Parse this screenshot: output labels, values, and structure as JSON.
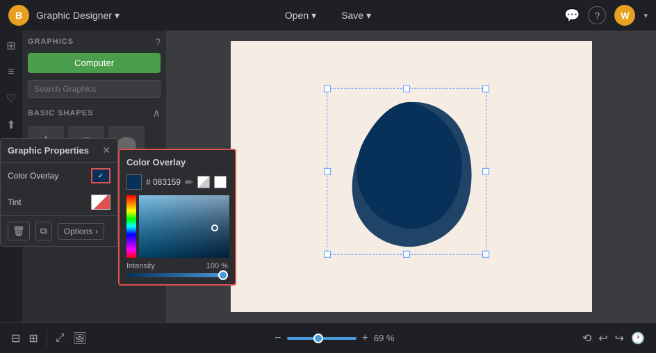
{
  "app": {
    "logo_letter": "B",
    "title": "Graphic Designer",
    "title_chevron": "▾"
  },
  "topbar": {
    "open_label": "Open",
    "save_label": "Save",
    "open_chevron": "▾",
    "save_chevron": "▾",
    "chat_icon": "💬",
    "help_icon": "?",
    "avatar_label": "W"
  },
  "sidebar": {
    "header": "GRAPHICS",
    "help_icon": "?",
    "computer_btn": "Computer",
    "search_placeholder": "Search Graphics",
    "basic_shapes_label": "BASIC SHAPES",
    "collapse_icon": "∧"
  },
  "graphic_properties": {
    "title": "Graphic Properties",
    "close_icon": "✕",
    "color_overlay_label": "Color Overlay",
    "tint_label": "Tint",
    "options_label": "Options",
    "options_chevron": "›",
    "trash_icon": "🗑",
    "copy_icon": "⧉"
  },
  "color_overlay": {
    "title": "Color Overlay",
    "hex_value": "# 083159",
    "eyedropper_icon": "✏",
    "intensity_label": "Intensity",
    "intensity_value": "100 %"
  },
  "zoom": {
    "minus_icon": "−",
    "plus_icon": "+",
    "value": "69 %"
  }
}
